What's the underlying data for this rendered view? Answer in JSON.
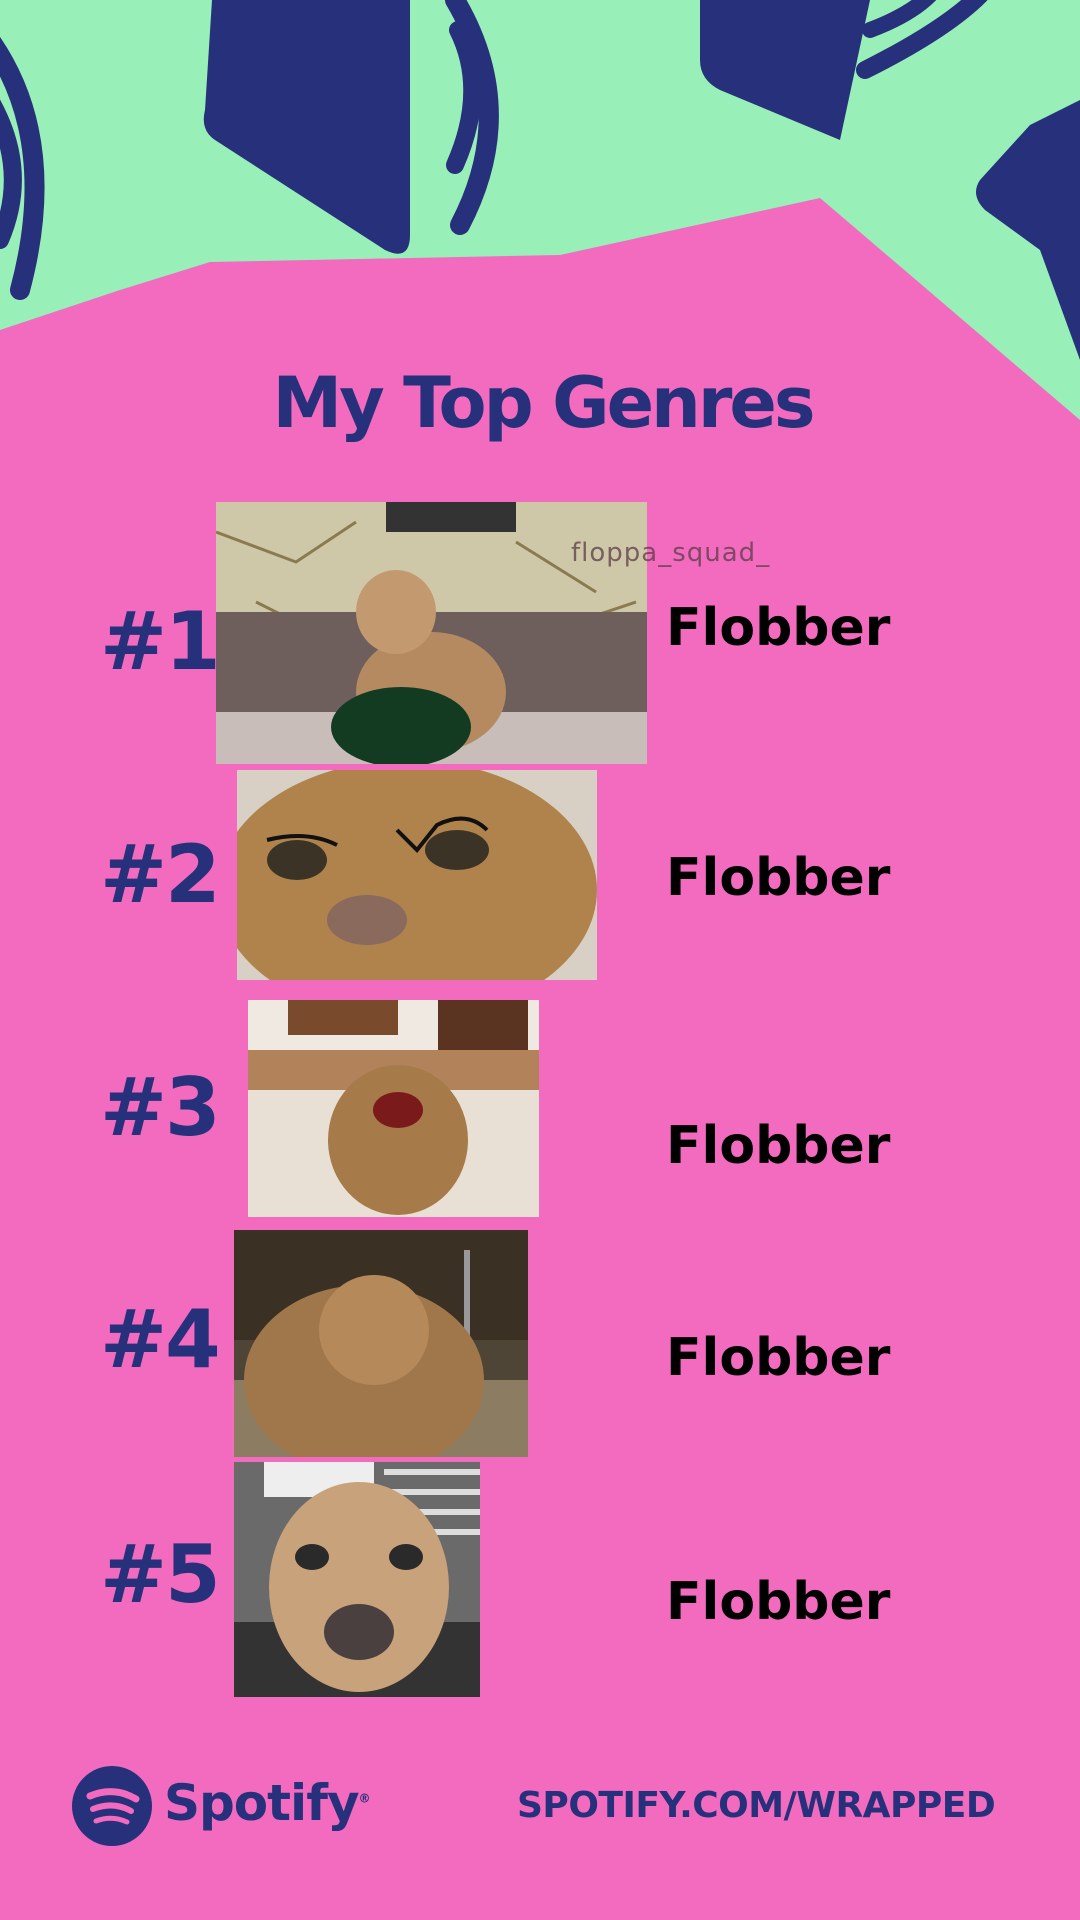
{
  "colors": {
    "background": "#f26bbf",
    "mint": "#98efb8",
    "navy": "#27307a",
    "text": "#000000"
  },
  "header": {
    "title": "My Top Genres"
  },
  "genres": [
    {
      "rank": "#1",
      "name": "Flobber"
    },
    {
      "rank": "#2",
      "name": "Flobber"
    },
    {
      "rank": "#3",
      "name": "Flobber"
    },
    {
      "rank": "#4",
      "name": "Flobber"
    },
    {
      "rank": "#5",
      "name": "Flobber"
    }
  ],
  "photo_watermark": "floppa_squad_",
  "footer": {
    "brand": "Spotify",
    "registered": "®",
    "url": "SPOTIFY.COM/WRAPPED",
    "logo_icon": "spotify-logo-icon"
  }
}
